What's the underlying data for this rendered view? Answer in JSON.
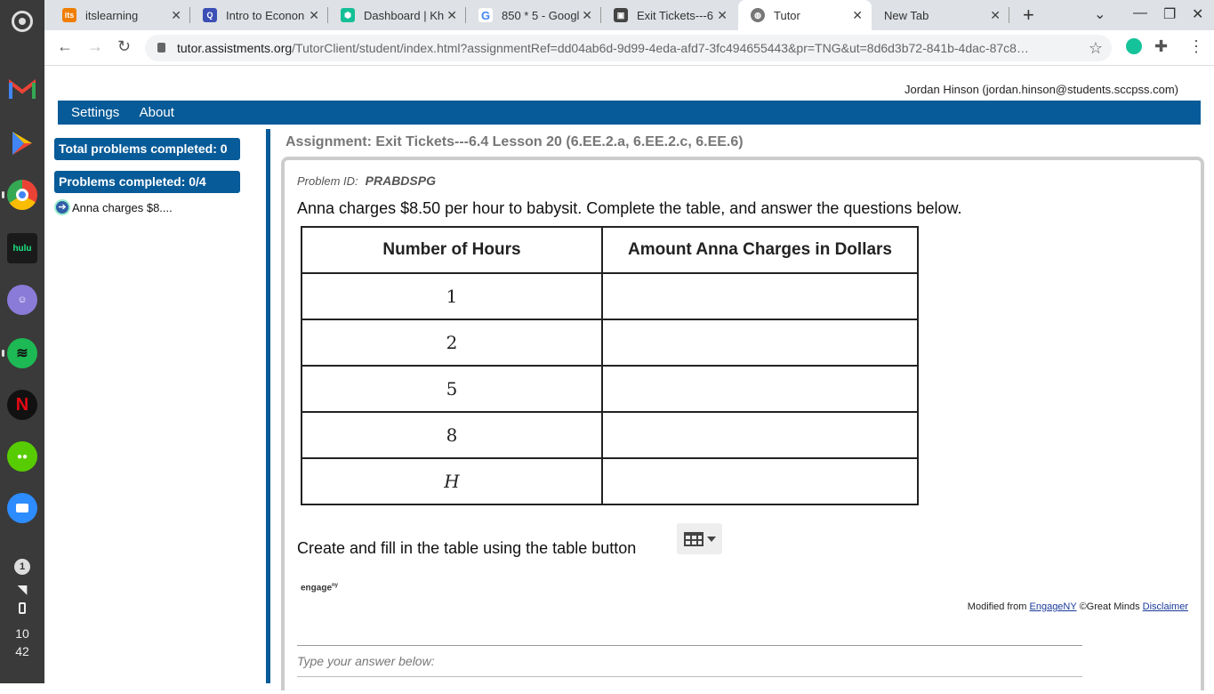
{
  "shelf": {
    "apps": [
      {
        "name": "gmail",
        "color": "#ea4335",
        "glyph": "M"
      },
      {
        "name": "play-store",
        "color": "#1a73e8",
        "glyph": "▶"
      },
      {
        "name": "chrome",
        "color": "#34a853",
        "glyph": "◉"
      },
      {
        "name": "hulu",
        "color": "#1a1a1a",
        "glyph": "hulu"
      },
      {
        "name": "anime-app",
        "color": "#7b6fd6",
        "glyph": "☺"
      },
      {
        "name": "spotify",
        "color": "#1db954",
        "glyph": "≋"
      },
      {
        "name": "netflix",
        "color": "#111111",
        "glyph": "N"
      },
      {
        "name": "duolingo",
        "color": "#58cc02",
        "glyph": "●●"
      },
      {
        "name": "zoom",
        "color": "#2d8cff",
        "glyph": "■"
      }
    ],
    "notification_count": "1",
    "clock_hour": "10",
    "clock_min": "42"
  },
  "tabs": [
    {
      "title": "itslearning",
      "icon": "its",
      "color": "#ef7d00"
    },
    {
      "title": "Intro to Econon",
      "icon": "Q",
      "color": "#3b4fb5"
    },
    {
      "title": "Dashboard | Kh",
      "icon": "⬢",
      "color": "#14bf96"
    },
    {
      "title": "850 * 5 - Googl",
      "icon": "G",
      "color": "#4285f4"
    },
    {
      "title": "Exit Tickets---6",
      "icon": "▣",
      "color": "#444444"
    },
    {
      "title": "Tutor",
      "icon": "◍",
      "color": "#666666"
    },
    {
      "title": "New Tab",
      "icon": "",
      "color": "transparent"
    }
  ],
  "browser": {
    "url_host": "tutor.assistments.org",
    "url_path": "/TutorClient/student/index.html?assignmentRef=dd04ab6d-9d99-4eda-afd7-3fc494655443&pr=TNG&ut=8d6d3b72-841b-4dac-87c8…"
  },
  "header": {
    "user": "Jordan Hinson (jordan.hinson@students.sccpss.com)",
    "menu": [
      "Settings",
      "About"
    ]
  },
  "sidebar": {
    "total_completed": "Total problems completed: 0",
    "problems_completed": "Problems completed: 0/4",
    "problem_link": "Anna charges $8...."
  },
  "main": {
    "assignment": "Assignment: Exit Tickets---6.4 Lesson 20 (6.EE.2.a, 6.EE.2.c, 6.EE.6)",
    "problem_id_label": "Problem ID:",
    "problem_id": "PRABDSPG",
    "statement": "Anna charges $8.50 per hour to babysit. Complete the table, and answer the questions below.",
    "table": {
      "headers": [
        "Number of Hours",
        "Amount Anna Charges in Dollars"
      ],
      "rows": [
        [
          "1",
          ""
        ],
        [
          "2",
          ""
        ],
        [
          "5",
          ""
        ],
        [
          "8",
          ""
        ],
        [
          "H",
          ""
        ]
      ]
    },
    "instruction": "Create and fill in the table using the table button",
    "engage_logo": "engage",
    "engage_sup": "ny",
    "credit_prefix": "Modified from",
    "credit_link": "EngageNY",
    "credit_middle": "©Great Minds",
    "credit_disclaimer": "Disclaimer",
    "answer_label": "Type your answer below:"
  }
}
